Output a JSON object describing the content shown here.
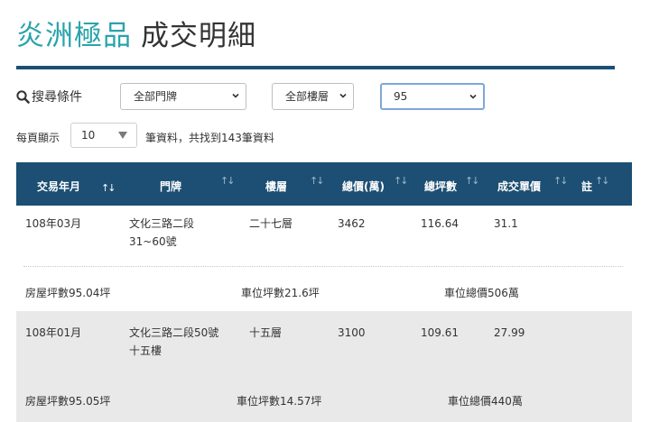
{
  "page": {
    "brand": "炎洲極品",
    "subtitle": "成交明細"
  },
  "search": {
    "label": "搜尋條件",
    "door_select": "全部門牌",
    "floor_select": "全部樓層",
    "year_select": "95"
  },
  "paging": {
    "label": "每頁顯示",
    "per_page": "10",
    "info_prefix": "筆資料，共找到",
    "total": "143",
    "info_suffix": "筆資料"
  },
  "table": {
    "headers": [
      "交易年月",
      "門牌",
      "樓層",
      "總價(萬)",
      "總坪數",
      "成交單價",
      "註"
    ],
    "sort_glyph": "↑↓",
    "rows": [
      {
        "date": "108年03月",
        "door_line1": "文化三路二段",
        "door_line2": "31~60號",
        "floor": "二十七層",
        "total_price": "3462",
        "total_area": "116.64",
        "unit_price": "31.1",
        "house_area": "房屋坪數95.04坪",
        "parking_area": "車位坪數21.6坪",
        "parking_price": "車位總價506萬"
      },
      {
        "date": "108年01月",
        "door_line1": "文化三路二段50號",
        "door_line2": "十五樓",
        "floor": "十五層",
        "total_price": "3100",
        "total_area": "109.61",
        "unit_price": "27.99",
        "house_area": "房屋坪數95.05坪",
        "parking_area": "車位坪數14.57坪",
        "parking_price": "車位總價440萬"
      }
    ]
  }
}
